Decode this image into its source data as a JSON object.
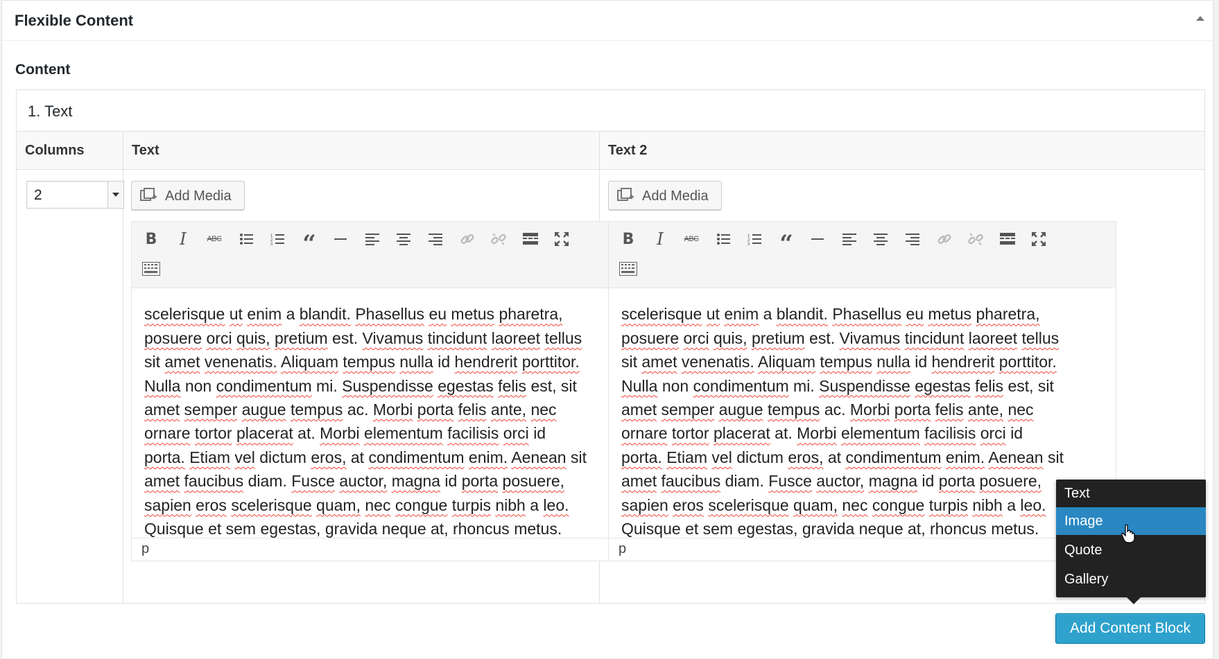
{
  "section": {
    "title": "Flexible Content",
    "field_label": "Content"
  },
  "layout": {
    "title": "1. Text",
    "headers": {
      "columns": "Columns",
      "text": "Text",
      "text2": "Text 2"
    },
    "columns_value": "2"
  },
  "editor": {
    "add_media_label": "Add Media",
    "path": "p",
    "lines": [
      [
        "scelerisque ut enim a blandit. Phasellus eu metus pharetra,"
      ],
      [
        "posuere orci quis, pretium est. Vivamus tincidunt laoreet tellus"
      ],
      [
        "sit amet venenatis. Aliquam tempus nulla id hendrerit porttitor."
      ],
      [
        "Nulla non condimentum mi. Suspendisse egestas felis est, sit"
      ],
      [
        "amet semper augue tempus ac. Morbi porta felis ante, nec"
      ],
      [
        "ornare tortor placerat at. Morbi elementum facilisis orci id"
      ],
      [
        "porta. Etiam vel dictum eros, at condimentum enim. Aenean sit"
      ],
      [
        "amet faucibus diam. Fusce auctor, magna id porta posuere,"
      ],
      [
        "sapien eros scelerisque quam, nec congue turpis nibh a leo."
      ],
      [
        "Quisque et sem egestas, gravida neque at, rhoncus metus."
      ]
    ],
    "toolbar_icons": [
      "bold-icon",
      "italic-icon",
      "strikethrough-icon",
      "bullet-list-icon",
      "numbered-list-icon",
      "blockquote-icon",
      "horizontal-rule-icon",
      "align-left-icon",
      "align-center-icon",
      "align-right-icon",
      "link-icon",
      "unlink-icon",
      "read-more-icon",
      "fullscreen-icon",
      "toolbar-toggle-icon"
    ]
  },
  "popup": {
    "items": [
      "Text",
      "Image",
      "Quote",
      "Gallery"
    ],
    "hovered": "Image"
  },
  "add_block_label": "Add Content Block",
  "colors": {
    "primary": "#2ea2cc",
    "hover": "#2a87c2",
    "popup_bg": "#222222"
  }
}
